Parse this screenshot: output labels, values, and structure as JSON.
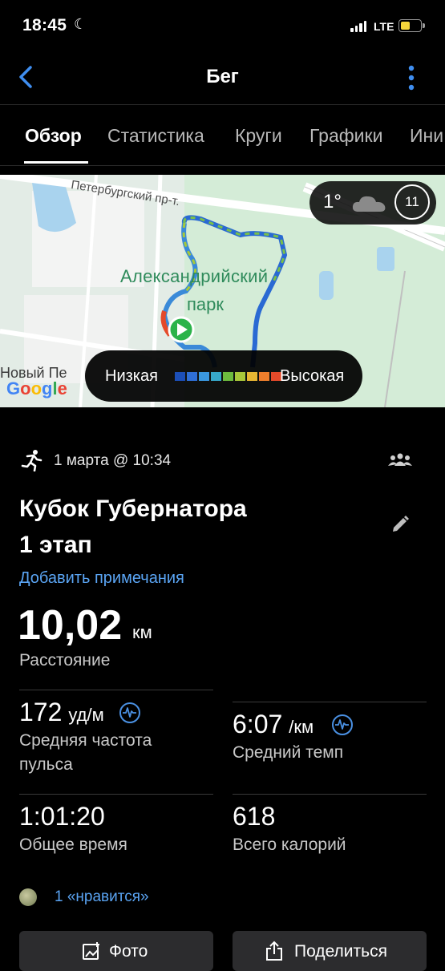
{
  "status_bar": {
    "time": "18:45",
    "network": "LTE"
  },
  "header": {
    "title": "Бег"
  },
  "tabs": [
    {
      "label": "Обзор",
      "active": true
    },
    {
      "label": "Статистика"
    },
    {
      "label": "Круги"
    },
    {
      "label": "Графики"
    },
    {
      "label": "Ини"
    }
  ],
  "map": {
    "street_label": "Петербургский пр-т.",
    "park_label_line1": "Александрийский",
    "park_label_line2": "парк",
    "district_label": "Новый Пе",
    "attribution": "Google",
    "weather": {
      "temperature": "1°",
      "wind": "11"
    },
    "legend": {
      "low": "Низкая",
      "high": "Высокая",
      "colors": [
        "#1c4fb8",
        "#2f6fd6",
        "#3a98e0",
        "#37a8c9",
        "#6dbb3e",
        "#a9c83a",
        "#e8b733",
        "#ef7f2c",
        "#e44a2a"
      ]
    }
  },
  "activity": {
    "date": "1 марта @ 10:34",
    "title_line1": "Кубок Губернатора",
    "title_line2": "1 этап",
    "add_notes": "Добавить примечания",
    "distance": {
      "value": "10,02",
      "unit": "км",
      "label": "Расстояние"
    },
    "stats": {
      "heart_rate": {
        "value": "172",
        "unit": "уд/м",
        "label_line1": "Средняя частота",
        "label_line2": "пульса"
      },
      "pace": {
        "value": "6:07",
        "unit": "/км",
        "label": "Средний темп"
      },
      "total_time": {
        "value": "1:01:20",
        "label": "Общее время"
      },
      "calories": {
        "value": "618",
        "label": "Всего калорий"
      }
    },
    "likes": "1 «нравится»"
  },
  "actions": {
    "photo": "Фото",
    "share": "Поделиться"
  },
  "colors": {
    "accent_link": "#5aa4f3",
    "pulse_icon": "#4a90e2",
    "background": "#000000"
  }
}
